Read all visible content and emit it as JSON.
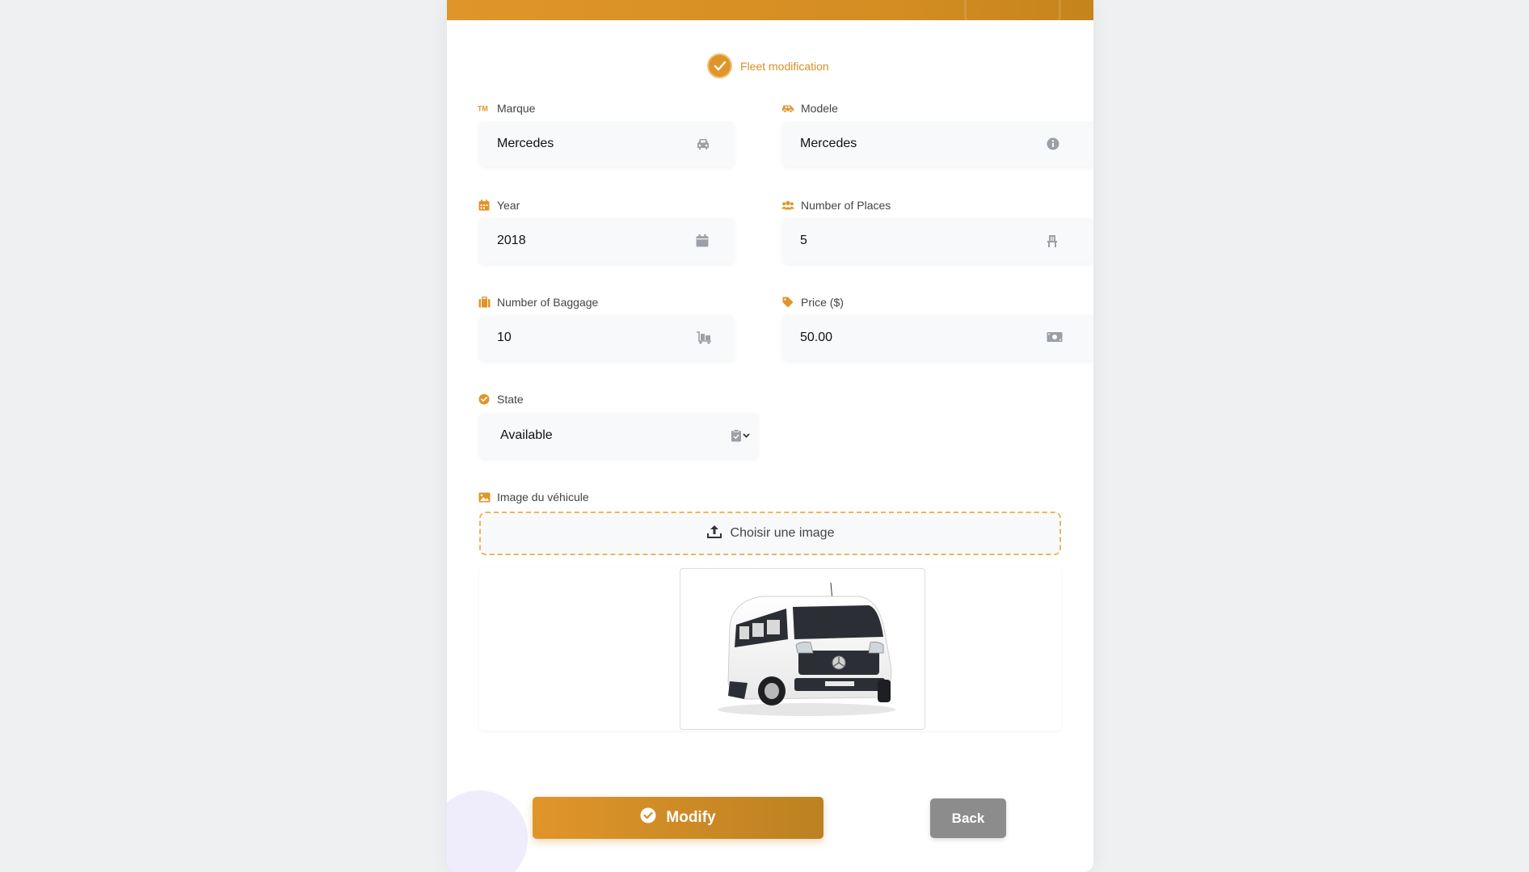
{
  "colors": {
    "accent": "#e0952a",
    "field_bg": "#f8f9fb",
    "back_button": "#8c8c8c",
    "upload_border": "#f0b45a"
  },
  "step": {
    "label": "Fleet modification"
  },
  "fields": {
    "marque": {
      "label": "Marque",
      "value": "Mercedes",
      "label_icon": "trademark-icon",
      "field_icon": "car-icon"
    },
    "modele": {
      "label": "Modele",
      "value": "Mercedes",
      "label_icon": "car-side-icon",
      "field_icon": "info-icon"
    },
    "year": {
      "label": "Year",
      "value": "2018",
      "label_icon": "calendar-icon",
      "field_icon": "calendar-icon"
    },
    "places": {
      "label": "Number of Places",
      "value": "5",
      "label_icon": "users-icon",
      "field_icon": "chair-icon"
    },
    "baggage": {
      "label": "Number of Baggage",
      "value": "10",
      "label_icon": "suitcase-icon",
      "field_icon": "luggage-cart-icon"
    },
    "price": {
      "label": "Price ($)",
      "value": "50.00",
      "label_icon": "tag-icon",
      "field_icon": "money-bill-icon"
    },
    "state": {
      "label": "State",
      "value": "Available",
      "label_icon": "check-circle-icon",
      "field_icon": "clipboard-check-icon"
    }
  },
  "image": {
    "label": "Image du véhicule",
    "upload_label": "Choisir une image",
    "label_icon": "image-icon",
    "upload_icon": "upload-icon",
    "preview_alt": "white Mercedes minibus"
  },
  "buttons": {
    "modify": "Modify",
    "back": "Back"
  }
}
